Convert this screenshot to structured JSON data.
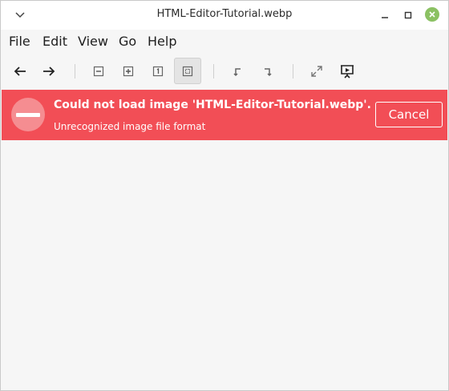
{
  "window": {
    "title": "HTML-Editor-Tutorial.webp"
  },
  "menubar": {
    "items": [
      "File",
      "Edit",
      "View",
      "Go",
      "Help"
    ]
  },
  "toolbar": {
    "buttons": [
      "back-icon",
      "forward-icon",
      "zoom-out-icon",
      "zoom-in-icon",
      "zoom-normal-icon",
      "zoom-fit-icon",
      "rotate-left-icon",
      "rotate-right-icon",
      "fullscreen-icon",
      "slideshow-icon"
    ]
  },
  "error": {
    "title": "Could not load image 'HTML-Editor-Tutorial.webp'.",
    "subtitle": "Unrecognized image file format",
    "cancel_label": "Cancel"
  },
  "colors": {
    "error_bar": "#f24e56",
    "close_button": "#8bc163"
  }
}
